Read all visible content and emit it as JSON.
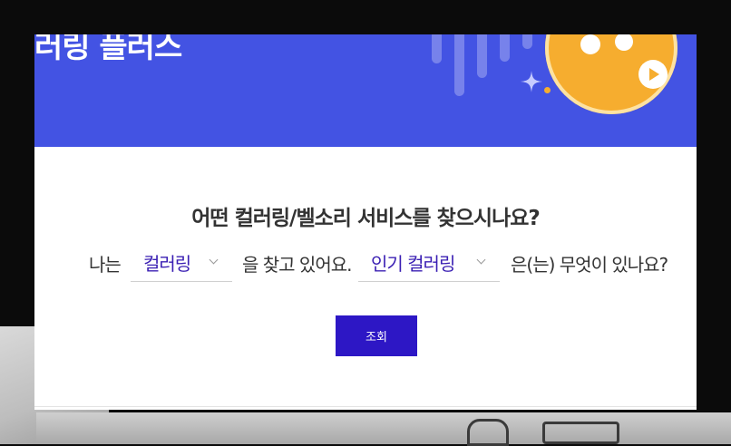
{
  "banner": {
    "title": "러링 플러스",
    "colors": {
      "background": "#4353e3",
      "coin": "#f6ad2f"
    },
    "icons": [
      "music-note-icon",
      "play-icon",
      "sparkle-icon"
    ]
  },
  "query": {
    "question": "어떤 컬러링/벨소리 서비스를 찾으시나요?",
    "prefix": "나는",
    "service_select": {
      "value": "컬러링"
    },
    "middle": "을 찾고 있어요.",
    "category_select": {
      "value": "인기 컬러링"
    },
    "suffix": "은(는) 무엇이 있나요?",
    "submit_label": "조회"
  },
  "colors": {
    "accent": "#2d17c5",
    "select_text": "#3a1fb3"
  }
}
